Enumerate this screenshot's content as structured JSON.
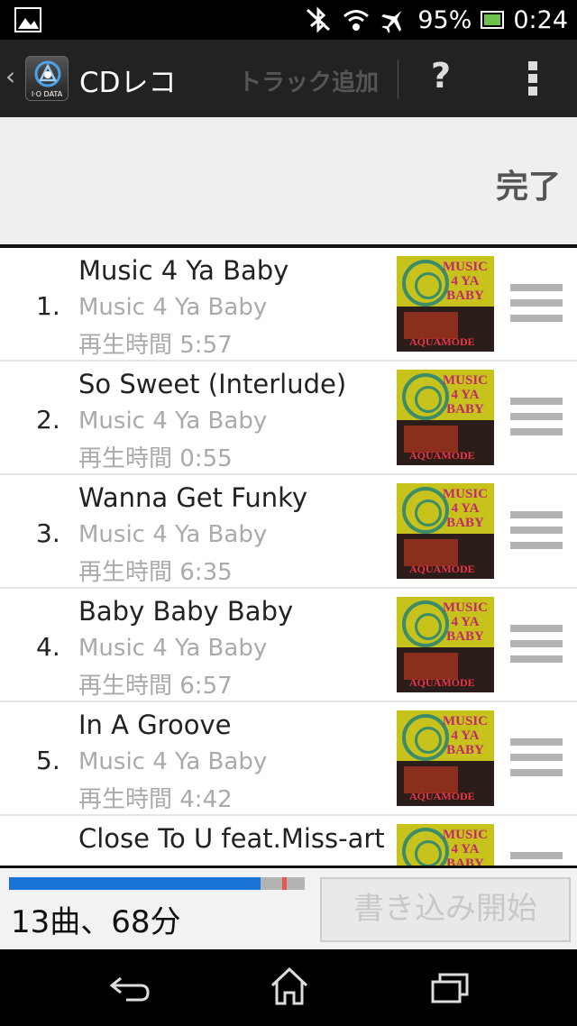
{
  "status_bar": {
    "battery_percent": "95%",
    "time": "0:24",
    "icons": [
      "image-icon",
      "bluetooth-off-icon",
      "wifi-icon",
      "airplane-icon",
      "battery-icon"
    ]
  },
  "action_bar": {
    "back_glyph": "‹",
    "app_title": "CDレコ",
    "add_track": "トラック追加",
    "help": "?",
    "logo_text": "I·O DATA"
  },
  "done_label": "完了",
  "tracks": [
    {
      "num": "1.",
      "title": "Music 4 Ya Baby",
      "album": "Music 4 Ya Baby",
      "time": "再生時間 5:57"
    },
    {
      "num": "2.",
      "title": "So Sweet (Interlude)",
      "album": "Music 4 Ya Baby",
      "time": "再生時間 0:55"
    },
    {
      "num": "3.",
      "title": "Wanna Get Funky",
      "album": "Music 4 Ya Baby",
      "time": "再生時間 6:35"
    },
    {
      "num": "4.",
      "title": "Baby Baby Baby",
      "album": "Music 4 Ya Baby",
      "time": "再生時間 6:57"
    },
    {
      "num": "5.",
      "title": "In A Groove",
      "album": "Music 4 Ya Baby",
      "time": "再生時間 4:42"
    },
    {
      "num": "",
      "title": "Close To U feat.Miss-art",
      "album": "",
      "time": ""
    }
  ],
  "album_art_text": {
    "top": "MUSIC 4 YA BABY",
    "bottom": "AQUAMODE"
  },
  "footer": {
    "summary": "13曲、68分",
    "write_button": "書き込み開始",
    "capacity_used_fraction": 0.85
  },
  "colors": {
    "progress": "#1a73d6",
    "progress_track": "#b3b3b3",
    "progress_marker": "#e25a4a",
    "action_bar": "#222222"
  }
}
